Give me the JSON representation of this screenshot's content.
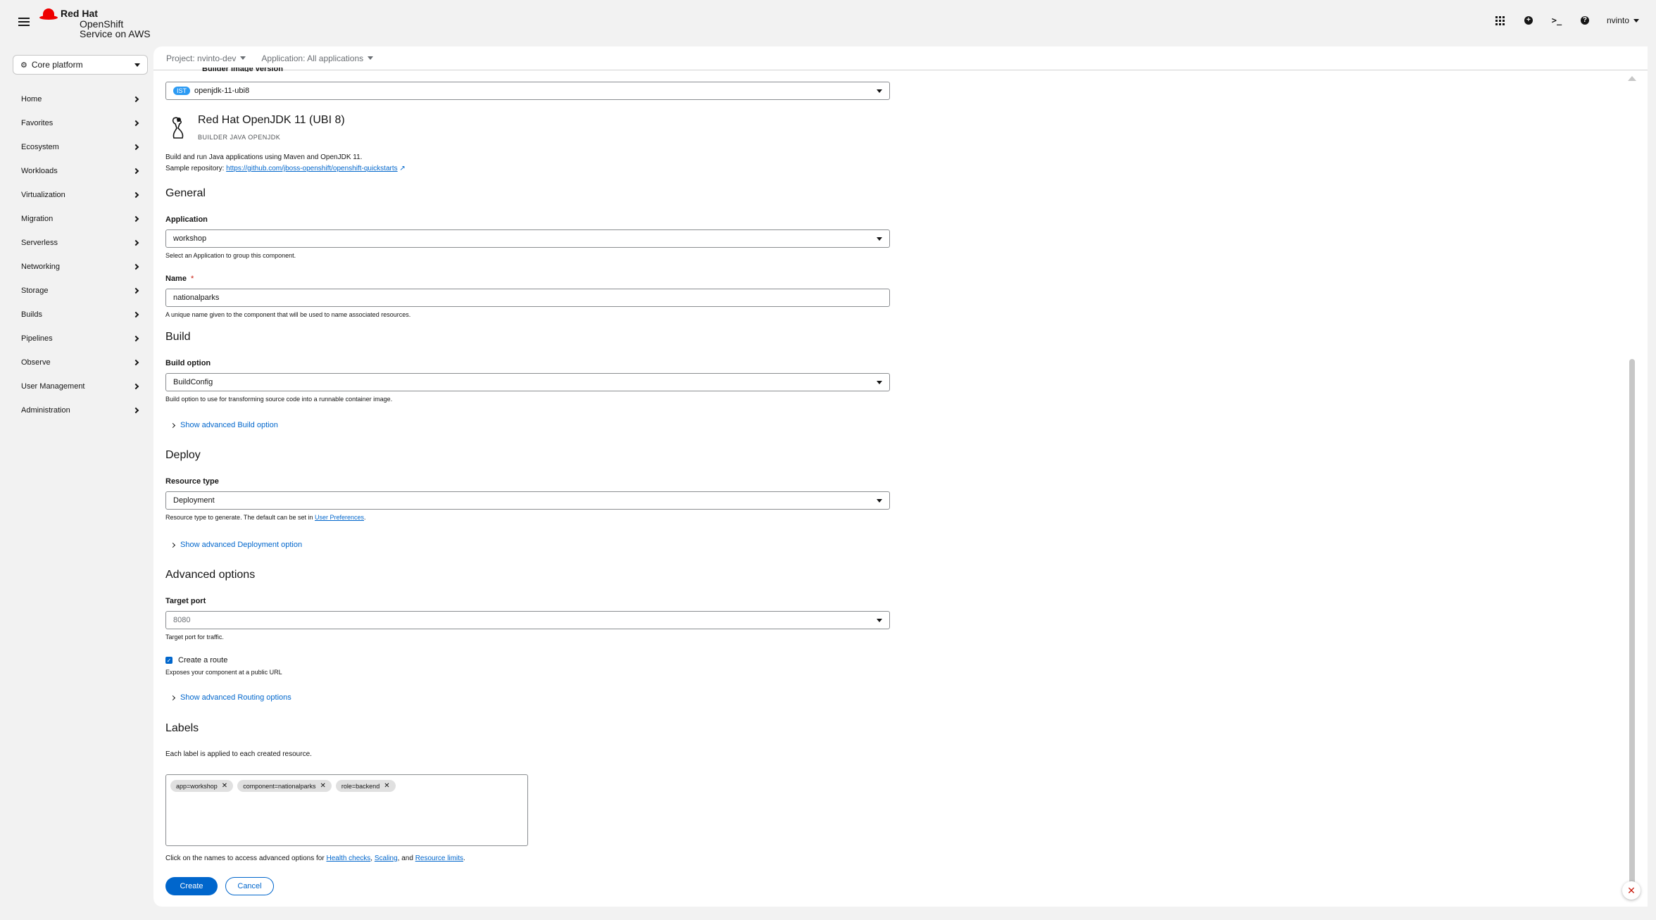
{
  "brand": {
    "line1": "Red Hat",
    "line2": "OpenShift",
    "line3": "Service on AWS"
  },
  "masthead": {
    "user": "nvinto",
    "terminal_glyph": ">_",
    "plus_glyph": "+",
    "help_glyph": "?"
  },
  "sidebar": {
    "perspective": "Core platform",
    "items": [
      {
        "label": "Home"
      },
      {
        "label": "Favorites"
      },
      {
        "label": "Ecosystem"
      },
      {
        "label": "Workloads"
      },
      {
        "label": "Virtualization"
      },
      {
        "label": "Migration"
      },
      {
        "label": "Serverless"
      },
      {
        "label": "Networking"
      },
      {
        "label": "Storage"
      },
      {
        "label": "Builds"
      },
      {
        "label": "Pipelines"
      },
      {
        "label": "Observe"
      },
      {
        "label": "User Management"
      },
      {
        "label": "Administration"
      }
    ]
  },
  "projectbar": {
    "project": "Project: nvinto-dev",
    "application": "Application: All applications"
  },
  "form": {
    "builder_image_version_label": "Builder Image version",
    "builder_image_version": {
      "badge": "IST",
      "value": "openjdk-11-ubi8"
    },
    "builder": {
      "title": "Red Hat OpenJDK 11 (UBI 8)",
      "tags": "BUILDER  JAVA  OPENJDK",
      "description": "Build and run Java applications using Maven and OpenJDK 11.",
      "sample_prefix": "Sample repository:",
      "sample_link": "https://github.com/jboss-openshift/openshift-quickstarts"
    },
    "general": {
      "heading": "General",
      "application_label": "Application",
      "application_value": "workshop",
      "application_help": "Select an Application to group this component.",
      "name_label": "Name",
      "name_required": "*",
      "name_value": "nationalparks",
      "name_help": "A unique name given to the component that will be used to name associated resources."
    },
    "build": {
      "heading": "Build",
      "option_label": "Build option",
      "option_value": "BuildConfig",
      "option_help": "Build option to use for transforming source code into a runnable container image.",
      "advanced": "Show advanced Build option"
    },
    "deploy": {
      "heading": "Deploy",
      "resource_label": "Resource type",
      "resource_value": "Deployment",
      "resource_help_prefix": "Resource type to generate. The default can be set in",
      "resource_help_link": "User Preferences",
      "resource_help_suffix": ".",
      "advanced": "Show advanced Deployment option"
    },
    "advanced": {
      "heading": "Advanced options",
      "port_label": "Target port",
      "port_value": "8080",
      "port_help": "Target port for traffic.",
      "route_label": "Create a route",
      "route_checked": true,
      "route_help": "Exposes your component at a public URL",
      "routing_advanced": "Show advanced Routing options"
    },
    "labels": {
      "heading": "Labels",
      "description": "Each label is applied to each created resource.",
      "chips": [
        {
          "text": "app=workshop"
        },
        {
          "text": "component=nationalparks"
        },
        {
          "text": "role=backend"
        }
      ]
    },
    "footer": {
      "prefix": "Click on the names to access advanced options for",
      "health": "Health checks",
      "sep1": ",",
      "scaling": "Scaling",
      "sep2": ", and",
      "limits": "Resource limits",
      "end": "."
    },
    "buttons": {
      "create": "Create",
      "cancel": "Cancel"
    }
  },
  "colors": {
    "accent": "#0066cc",
    "brand": "#ee0000",
    "required": "#c9190b"
  }
}
